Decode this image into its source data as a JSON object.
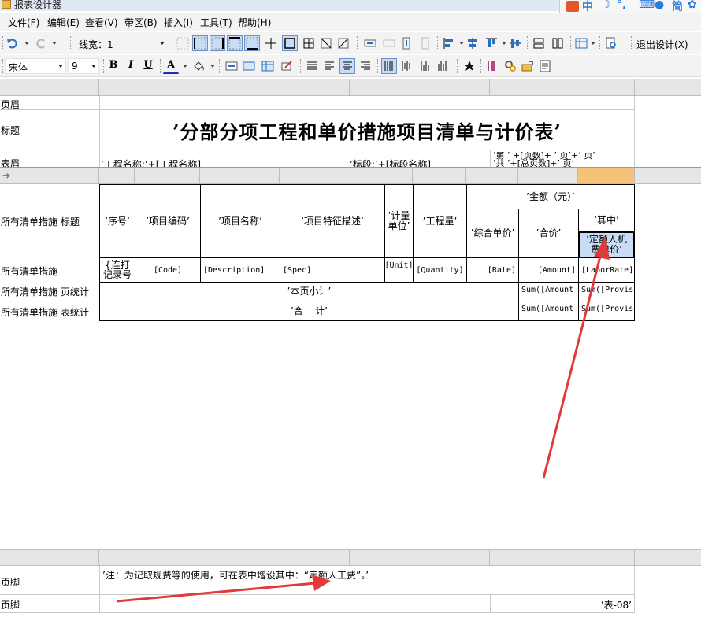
{
  "window": {
    "title": "报表设计器"
  },
  "ime": {
    "items": [
      "中",
      "简"
    ]
  },
  "menu": [
    "文件(F)",
    "编辑(E)",
    "查看(V)",
    "带区(B)",
    "插入(I)",
    "工具(T)",
    "帮助(H)"
  ],
  "toolbar1": {
    "line_width_label": "线宽：1",
    "exit_design": "退出设计(X)"
  },
  "toolbar2": {
    "font_name": "宋体",
    "font_size": "9",
    "bold": "B",
    "italic": "I",
    "underline": "U",
    "font_color_letter": "A"
  },
  "bands": {
    "page_header": "页眉",
    "title": "标题",
    "table_header": "表眉",
    "detail_title": "所有清单措施 标题",
    "detail": "所有清单措施",
    "page_sum": "所有清单措施 页统计",
    "table_sum": "所有清单措施 表统计",
    "page_footer_1": "页脚",
    "page_footer_2": "页脚"
  },
  "report": {
    "title": "’分部分项工程和单价措施项目清单与计价表’",
    "project_name": "’工程名称:’+[工程名称]",
    "section_name": "’标段:’+[标段名称]",
    "page_info_1": "’第 ’ +[页数]+ ’ 页’+’ 页’",
    "page_info_2": "’共 ’+[总页数]+’ 页’"
  },
  "columns": {
    "seq": "’序号’",
    "code": "’项目编码’",
    "name": "’项目名称’",
    "spec": "’项目特征描述’",
    "unit": "’计量单位’",
    "quantity": "’工程量’",
    "amount_group": "’金额（元）’",
    "rate": "’综合单价’",
    "total": "’合价’",
    "of_which": "’其中’",
    "labor_rate": "’定额人机费单价’"
  },
  "detail_fields": {
    "seq": "{连打记录号",
    "code": "[Code]",
    "name": "[Description]",
    "spec": "[Spec]",
    "unit": "[Unit]",
    "quantity": "[Quantity]",
    "rate": "[Rate]",
    "total": "[Amount]",
    "labor": "[LaborRate]"
  },
  "sums": {
    "page_label": "’本页小计’",
    "page_amount": "Sum([Amount",
    "page_prov": "Sum([Provis",
    "table_label": "’合    计’",
    "table_amount": "Sum([Amount",
    "table_prov": "Sum([Provis"
  },
  "footer": {
    "note": "’注：为记取规费等的使用，可在表中增设其中：“定额人工费”。’",
    "table_no": "’表-08’"
  },
  "colors": {
    "annotation_arrow": "#e03a3a",
    "ruler_highlight": "#f5c27a",
    "selection": "#c9dcf5"
  }
}
